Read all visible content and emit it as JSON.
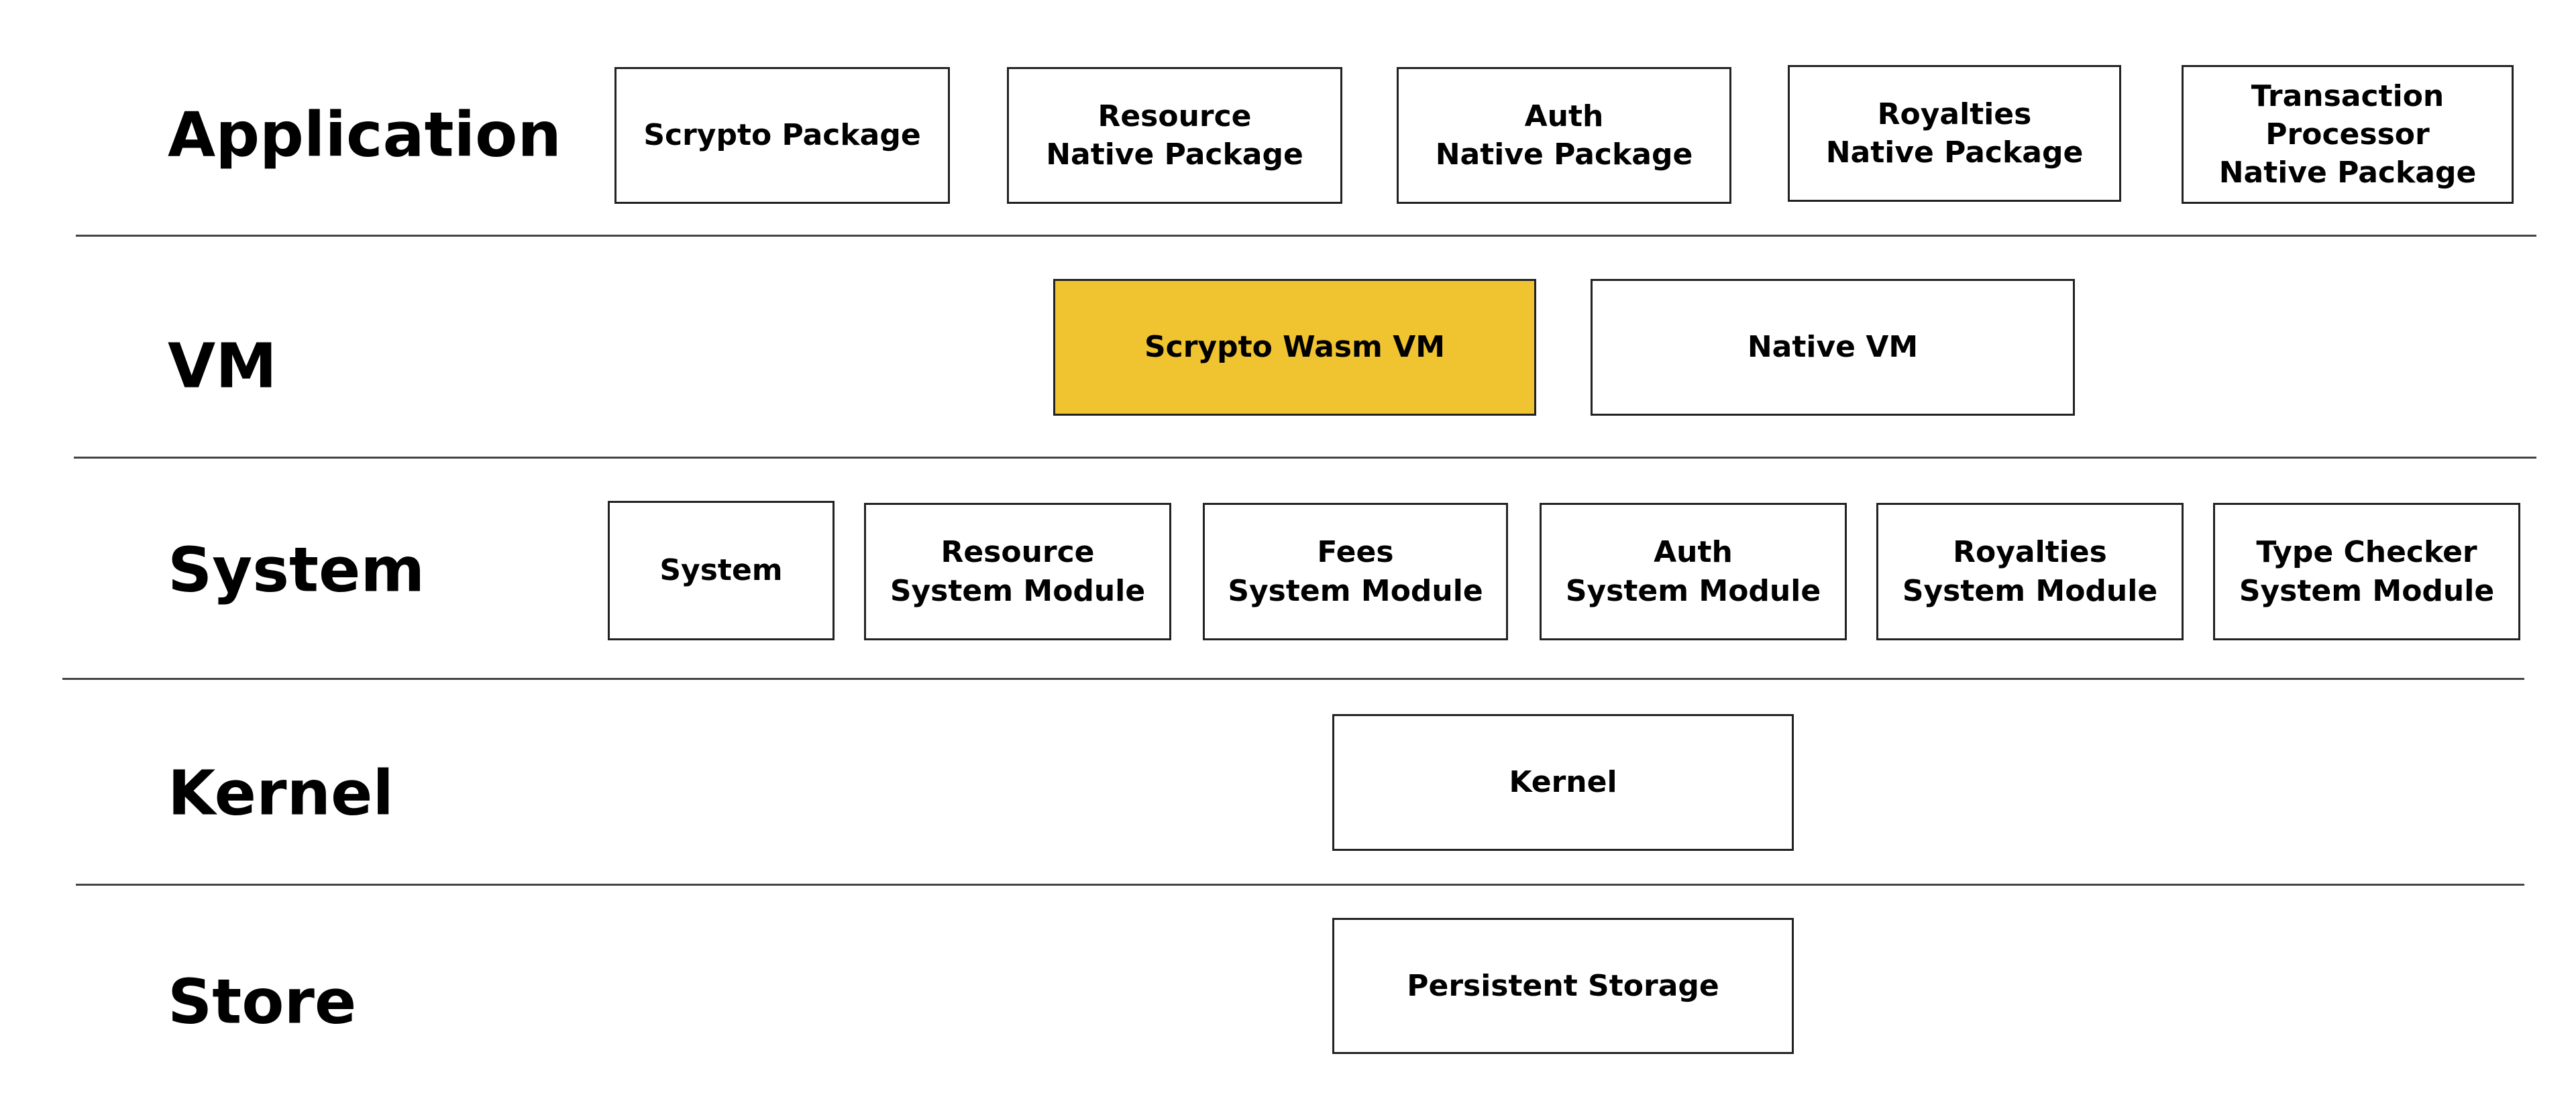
{
  "layers": [
    {
      "label": "Application",
      "boxes": [
        "Scrypto Package",
        "Resource\nNative Package",
        "Auth\nNative Package",
        "Royalties\nNative Package",
        "Transaction\nProcessor\nNative Package"
      ]
    },
    {
      "label": "VM",
      "boxes": [
        "Scrypto Wasm VM",
        "Native VM"
      ]
    },
    {
      "label": "System",
      "boxes": [
        "System",
        "Resource\nSystem Module",
        "Fees\nSystem Module",
        "Auth\nSystem Module",
        "Royalties\nSystem Module",
        "Type Checker\nSystem Module"
      ]
    },
    {
      "label": "Kernel",
      "boxes": [
        "Kernel"
      ]
    },
    {
      "label": "Store",
      "boxes": [
        "Persistent Storage"
      ]
    }
  ],
  "highlight_color": "#f0c330",
  "highlighted_box": "Scrypto Wasm VM"
}
